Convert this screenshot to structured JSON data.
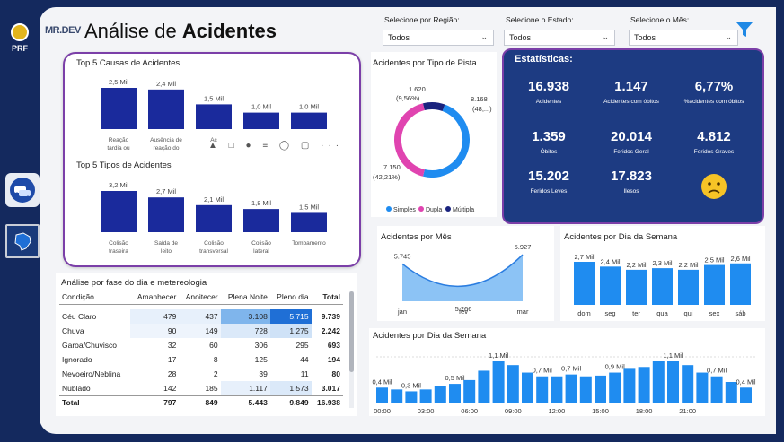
{
  "brand": "MR.DEV",
  "logo_text": "PRF",
  "title_plain": "Análise de ",
  "title_bold": "Acidentes",
  "filters": [
    {
      "label": "Selecione por Região:",
      "value": "Todos"
    },
    {
      "label": "Selecione o Estado:",
      "value": "Todos"
    },
    {
      "label": "Selecione o Mês:",
      "value": "Todos"
    }
  ],
  "causas": {
    "title": "Top 5 Causas de Acidentes",
    "bars": [
      {
        "value_label": "2,5 Mil",
        "value": 2.5,
        "cat": "Reação tardia ou ineficient..."
      },
      {
        "value_label": "2,4 Mil",
        "value": 2.4,
        "cat": "Ausência de reação do co..."
      },
      {
        "value_label": "1,5 Mil",
        "value": 1.5,
        "cat": "Ac"
      },
      {
        "value_label": "1,0 Mil",
        "value": 1.0,
        "cat": ""
      },
      {
        "value_label": "1,0 Mil",
        "value": 1.0,
        "cat": ""
      }
    ]
  },
  "tipos": {
    "title": "Top 5 Tipos de Acidentes",
    "bars": [
      {
        "value_label": "3,2 Mil",
        "value": 3.2,
        "cat": "Colisão traseira"
      },
      {
        "value_label": "2,7 Mil",
        "value": 2.7,
        "cat": "Saída de leito carroçável"
      },
      {
        "value_label": "2,1 Mil",
        "value": 2.1,
        "cat": "Colisão transversal"
      },
      {
        "value_label": "1,8 Mil",
        "value": 1.8,
        "cat": "Colisão lateral mesmo senti..."
      },
      {
        "value_label": "1,5 Mil",
        "value": 1.5,
        "cat": "Tombamento"
      }
    ]
  },
  "pista": {
    "title": "Acidentes por Tipo de Pista",
    "top_label": "1.620",
    "top_pct": "(9,56%)",
    "right_label": "8.168",
    "right_pct": "(48,...)",
    "left_label": "7.150",
    "left_pct": "(42,21%)",
    "legend": [
      {
        "name": "Simples",
        "color": "#1f8cf0"
      },
      {
        "name": "Dupla",
        "color": "#e044b0"
      },
      {
        "name": "Múltipla",
        "color": "#1a237e"
      }
    ]
  },
  "stats": {
    "title": "Estatísticas:",
    "items": [
      {
        "value": "16.938",
        "label": "Acidentes"
      },
      {
        "value": "1.147",
        "label": "Acidentes com óbitos"
      },
      {
        "value": "6,77%",
        "label": "%acidentes com óbitos"
      },
      {
        "value": "1.359",
        "label": "Óbitos"
      },
      {
        "value": "20.014",
        "label": "Feridos Geral"
      },
      {
        "value": "4.812",
        "label": "Feridos Graves"
      },
      {
        "value": "15.202",
        "label": "Feridos Leves"
      },
      {
        "value": "17.823",
        "label": "Ilesos"
      }
    ]
  },
  "mes": {
    "title": "Acidentes por Mês",
    "points": [
      {
        "x": "jan",
        "v": "5.745"
      },
      {
        "x": "fev",
        "v": "5.266"
      },
      {
        "x": "mar",
        "v": "5.927"
      }
    ]
  },
  "dia_semana": {
    "title": "Acidentes por Dia da Semana",
    "bars": [
      {
        "x": "dom",
        "label": "2,7 Mil",
        "value": 2.7
      },
      {
        "x": "seg",
        "label": "2,4 Mil",
        "value": 2.4
      },
      {
        "x": "ter",
        "label": "2,2 Mil",
        "value": 2.2
      },
      {
        "x": "qua",
        "label": "2,3 Mil",
        "value": 2.3
      },
      {
        "x": "qui",
        "label": "2,2 Mil",
        "value": 2.2
      },
      {
        "x": "sex",
        "label": "2,5 Mil",
        "value": 2.5
      },
      {
        "x": "sáb",
        "label": "2,6 Mil",
        "value": 2.6
      }
    ]
  },
  "tabela": {
    "title": "Análise por fase do dia e metereologia",
    "headers": [
      "Condição",
      "Amanhecer",
      "Anoitecer",
      "Plena Noite",
      "Pleno dia",
      "Total"
    ],
    "rows": [
      [
        "Céu Claro",
        "479",
        "437",
        "3.108",
        "5.715",
        "9.739"
      ],
      [
        "Chuva",
        "90",
        "149",
        "728",
        "1.275",
        "2.242"
      ],
      [
        "Garoa/Chuvisco",
        "32",
        "60",
        "306",
        "295",
        "693"
      ],
      [
        "Ignorado",
        "17",
        "8",
        "125",
        "44",
        "194"
      ],
      [
        "Nevoeiro/Neblina",
        "28",
        "2",
        "39",
        "11",
        "80"
      ],
      [
        "Nublado",
        "142",
        "185",
        "1.117",
        "1.573",
        "3.017"
      ]
    ],
    "total": [
      "Total",
      "797",
      "849",
      "5.443",
      "9.849",
      "16.938"
    ]
  },
  "hora": {
    "title": "Acidentes por Dia da Semana",
    "labels": [
      "0,4 Mil",
      "0,3 Mil",
      "0,5 Mil",
      "1,1 Mil",
      "0,7 Mil",
      "0,7 Mil",
      "0,9 Mil",
      "1,1 Mil",
      "0,7 Mil",
      "0,4 Mil"
    ],
    "ticks": [
      "00:00",
      "03:00",
      "06:00",
      "09:00",
      "12:00",
      "15:00",
      "18:00",
      "21:00"
    ],
    "values": [
      0.4,
      0.35,
      0.3,
      0.35,
      0.45,
      0.5,
      0.6,
      0.85,
      1.1,
      1.0,
      0.8,
      0.7,
      0.7,
      0.75,
      0.7,
      0.72,
      0.8,
      0.9,
      0.95,
      1.1,
      1.1,
      1.0,
      0.8,
      0.7,
      0.55,
      0.4
    ]
  }
}
